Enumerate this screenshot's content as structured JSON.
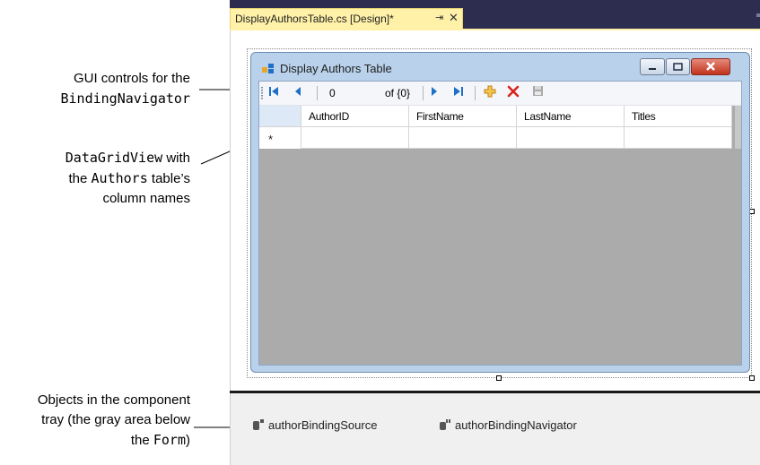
{
  "callouts": {
    "navigator": {
      "line1": "GUI controls for the",
      "code": "BindingNavigator"
    },
    "datagrid": {
      "code1": "DataGridView",
      "text1": " with",
      "text2": "the ",
      "code2": "Authors",
      "text3": " table’s",
      "text4": "column names"
    },
    "tray": {
      "line1": "Objects in the component",
      "line2": "tray (the gray area below",
      "text3": "the ",
      "code": "Form",
      "text4": ")"
    }
  },
  "editor": {
    "tab_title": "DisplayAuthorsTable.cs [Design]*",
    "tab_pin": "⇥",
    "tab_close": "✕"
  },
  "form": {
    "title": "Display Authors Table"
  },
  "navigator": {
    "position_value": "0",
    "of_label": "of {0}"
  },
  "grid": {
    "columns": [
      "AuthorID",
      "FirstName",
      "LastName",
      "Titles"
    ],
    "new_row_marker": "*"
  },
  "tray": {
    "items": [
      "authorBindingSource",
      "authorBindingNavigator"
    ]
  },
  "colors": {
    "tab_background": "#fff1a8",
    "form_frame": "#b9d1ea",
    "grid_background": "#ababab",
    "navigator_icon_blue": "#1e6fc8",
    "delete_red": "#d9241b",
    "add_gold": "#e8a62a"
  },
  "icons": [
    "form-app-icon",
    "move-first-icon",
    "move-previous-icon",
    "move-next-icon",
    "move-last-icon",
    "add-new-icon",
    "delete-icon",
    "save-icon",
    "binding-source-icon",
    "binding-navigator-icon"
  ]
}
